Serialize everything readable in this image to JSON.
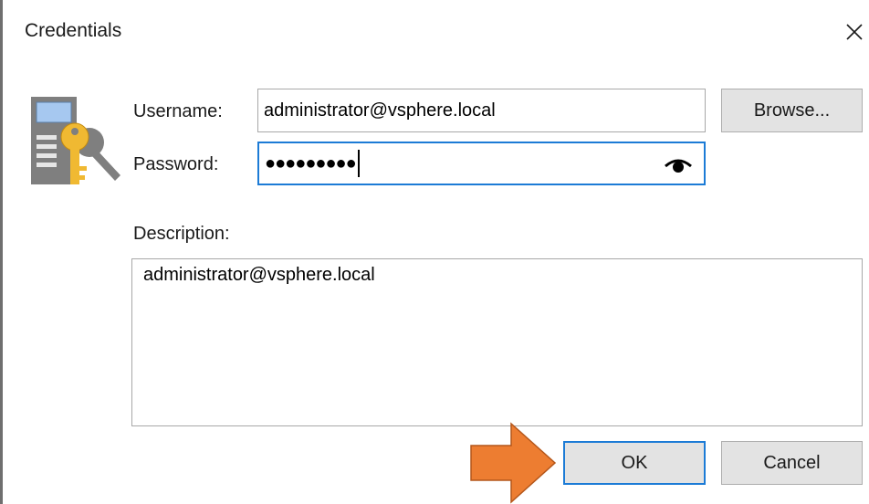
{
  "window": {
    "title": "Credentials",
    "close_icon": "close-icon"
  },
  "form": {
    "username_label": "Username:",
    "username_value": "administrator@vsphere.local",
    "browse_label": "Browse...",
    "password_label": "Password:",
    "password_masked": "●●●●●●●●●",
    "show_password_icon": "eye-icon",
    "description_label": "Description:",
    "description_value": "administrator@vsphere.local"
  },
  "buttons": {
    "ok_label": "OK",
    "cancel_label": "Cancel"
  },
  "annotation": {
    "arrow_icon": "orange-arrow-icon",
    "arrow_color": "#ed7d31"
  },
  "colors": {
    "focus_border": "#1c7bd6",
    "button_bg": "#e3e3e3"
  }
}
